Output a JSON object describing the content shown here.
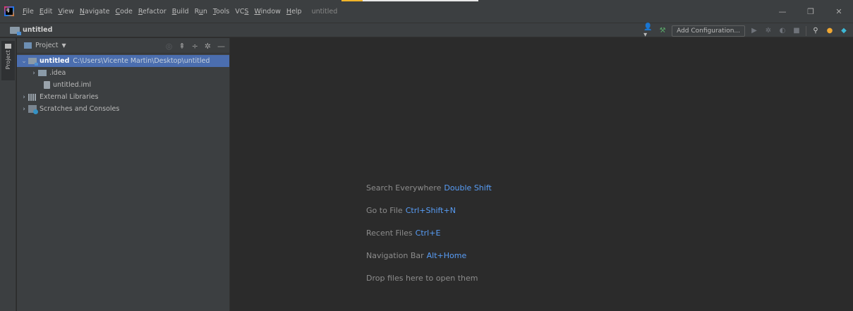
{
  "window": {
    "title": "untitled",
    "menu": [
      {
        "u": "F",
        "rest": "ile"
      },
      {
        "u": "E",
        "rest": "dit"
      },
      {
        "u": "V",
        "rest": "iew"
      },
      {
        "u": "N",
        "rest": "avigate"
      },
      {
        "u": "C",
        "rest": "ode"
      },
      {
        "u": "R",
        "rest": "efactor"
      },
      {
        "u": "B",
        "rest": "uild"
      },
      {
        "pre": "R",
        "u": "u",
        "rest": "n"
      },
      {
        "u": "T",
        "rest": "ools"
      },
      {
        "pre": "VC",
        "u": "S",
        "rest": ""
      },
      {
        "u": "W",
        "rest": "indow"
      },
      {
        "u": "H",
        "rest": "elp"
      }
    ],
    "controls": {
      "minimize": "—",
      "restore": "❐",
      "close": "✕"
    }
  },
  "navbar": {
    "breadcrumb": "untitled",
    "add_configuration": "Add Configuration..."
  },
  "toolstrip": {
    "project_tab": "Project"
  },
  "project_panel": {
    "view_label": "Project",
    "tree": {
      "root_name": "untitled",
      "root_path": "C:\\Users\\Vicente Martin\\Desktop\\untitled",
      "idea_folder": ".idea",
      "iml_file": "untitled.iml",
      "external_libraries": "External Libraries",
      "scratches": "Scratches and Consoles"
    }
  },
  "editor": {
    "hints": [
      {
        "label": "Search Everywhere",
        "key": "Double Shift"
      },
      {
        "label": "Go to File",
        "key": "Ctrl+Shift+N"
      },
      {
        "label": "Recent Files",
        "key": "Ctrl+E"
      },
      {
        "label": "Navigation Bar",
        "key": "Alt+Home"
      },
      {
        "label": "Drop files here to open them",
        "key": ""
      }
    ]
  },
  "colors": {
    "background": "#2b2b2b",
    "panel": "#3c3f41",
    "selection": "#4b6eaf",
    "shortcut": "#589df6"
  }
}
